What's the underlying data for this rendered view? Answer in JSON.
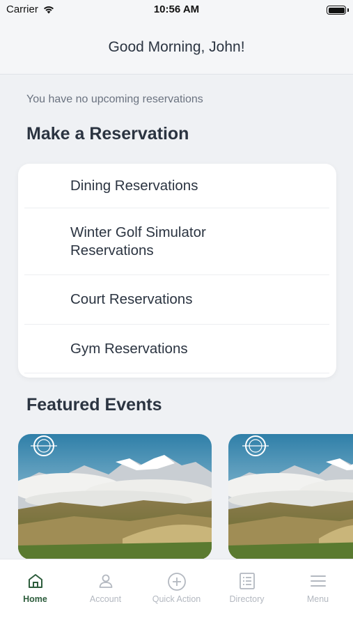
{
  "status_bar": {
    "carrier": "Carrier",
    "time": "10:56 AM"
  },
  "header": {
    "greeting": "Good Morning, John!"
  },
  "main": {
    "no_reservations_text": "You have no upcoming reservations",
    "make_reservation_title": "Make a Reservation",
    "reservations": [
      {
        "label": "Dining Reservations"
      },
      {
        "label": "Winter Golf Simulator Reservations"
      },
      {
        "label": "Court Reservations"
      },
      {
        "label": "Gym Reservations"
      }
    ],
    "featured_events_title": "Featured Events",
    "events": [
      {
        "logo": "3C"
      },
      {
        "logo": "3C"
      }
    ]
  },
  "tabbar": {
    "tabs": [
      {
        "label": "Home",
        "icon": "home-icon",
        "active": true
      },
      {
        "label": "Account",
        "icon": "person-icon",
        "active": false
      },
      {
        "label": "Quick Action",
        "icon": "plus-circle-icon",
        "active": false
      },
      {
        "label": "Directory",
        "icon": "list-icon",
        "active": false
      },
      {
        "label": "Menu",
        "icon": "hamburger-icon",
        "active": false
      }
    ]
  },
  "colors": {
    "background": "#eff1f4",
    "card": "#ffffff",
    "text_primary": "#2b3441",
    "text_secondary": "#6b7380",
    "accent_active": "#2d5d3c",
    "tab_inactive": "#b3b8c0"
  }
}
